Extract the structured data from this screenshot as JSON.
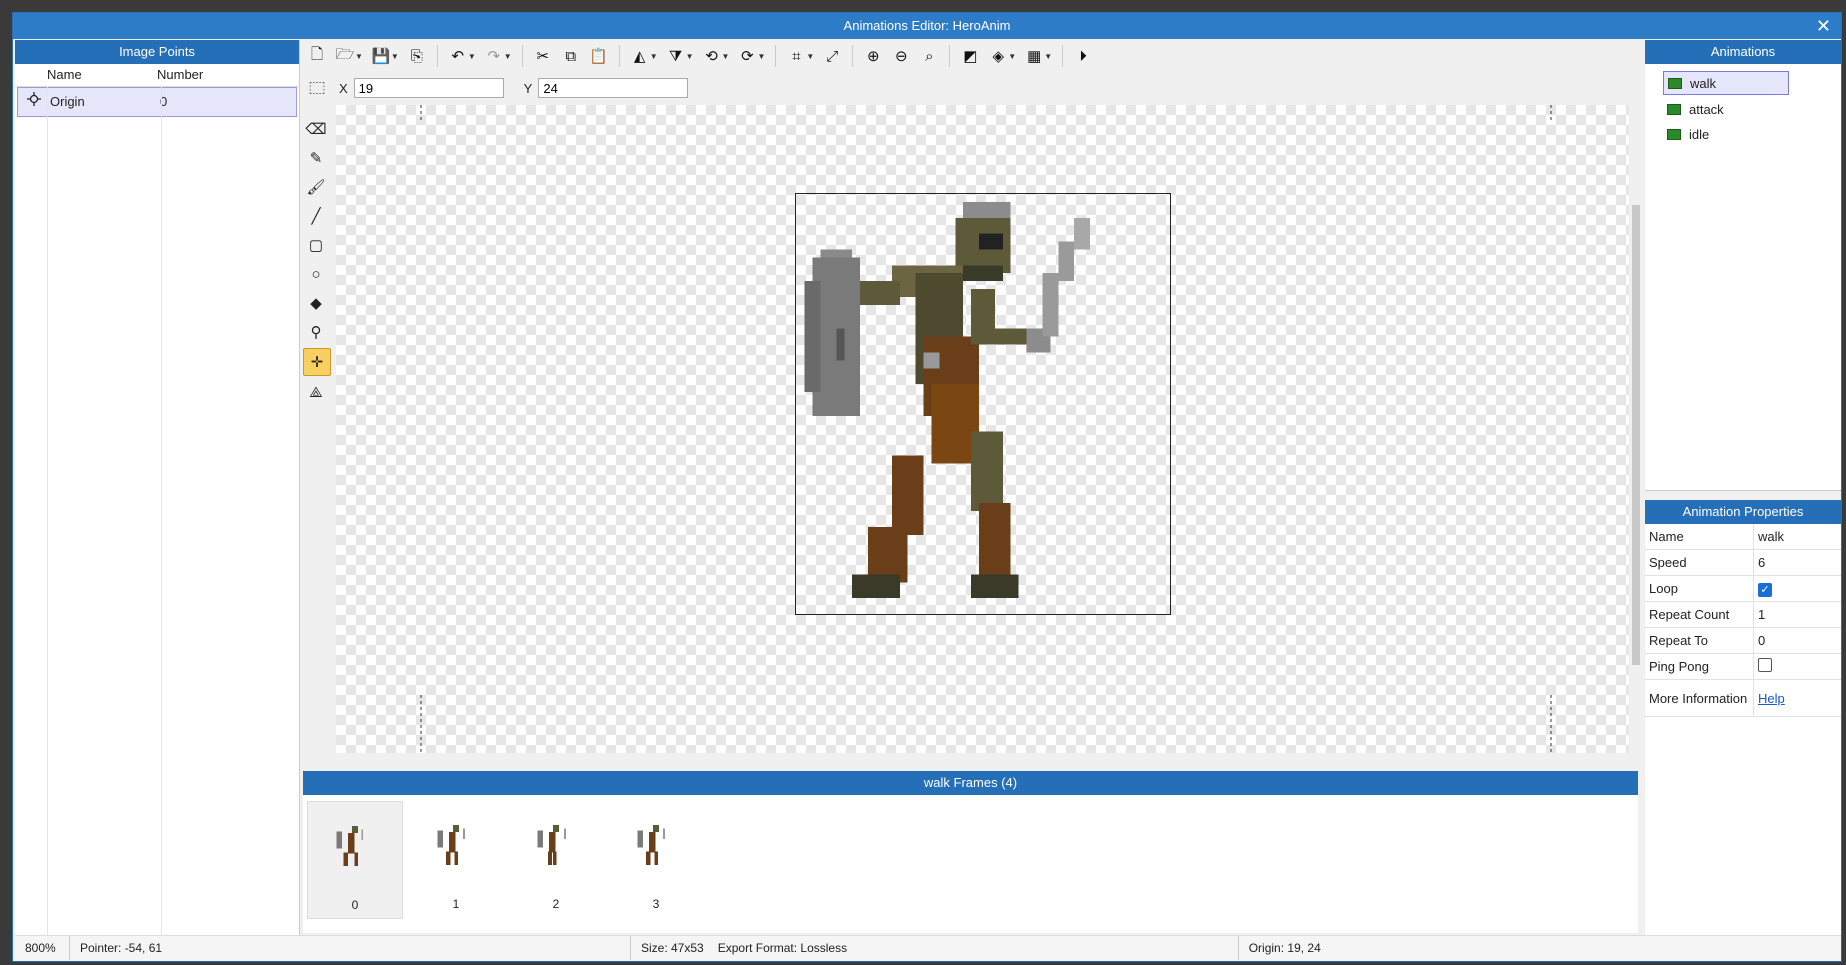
{
  "window": {
    "title": "Animations Editor: HeroAnim",
    "close_label": "✕"
  },
  "image_points": {
    "title": "Image Points",
    "col_name": "Name",
    "col_number": "Number",
    "rows": [
      {
        "icon": "crosshair-icon",
        "name": "Origin",
        "number": "0"
      }
    ]
  },
  "coords": {
    "x_label": "X",
    "x_value": "19",
    "y_label": "Y",
    "y_value": "24"
  },
  "animations": {
    "title": "Animations",
    "items": [
      {
        "label": "walk",
        "selected": true
      },
      {
        "label": "attack"
      },
      {
        "label": "idle"
      }
    ]
  },
  "properties": {
    "title": "Animation Properties",
    "name_key": "Name",
    "name_val": "walk",
    "speed_key": "Speed",
    "speed_val": "6",
    "loop_key": "Loop",
    "loop_val": true,
    "repeat_count_key": "Repeat Count",
    "repeat_count_val": "1",
    "repeat_to_key": "Repeat To",
    "repeat_to_val": "0",
    "pingpong_key": "Ping Pong",
    "pingpong_val": false,
    "more_key": "More Information",
    "more_link": "Help"
  },
  "frames": {
    "title": "walk Frames (4)",
    "items": [
      "0",
      "1",
      "2",
      "3"
    ]
  },
  "status": {
    "zoom": "800%",
    "pointer": "Pointer: -54, 61",
    "size": "Size: 47x53",
    "export": "Export Format: Lossless",
    "origin": "Origin: 19, 24"
  }
}
